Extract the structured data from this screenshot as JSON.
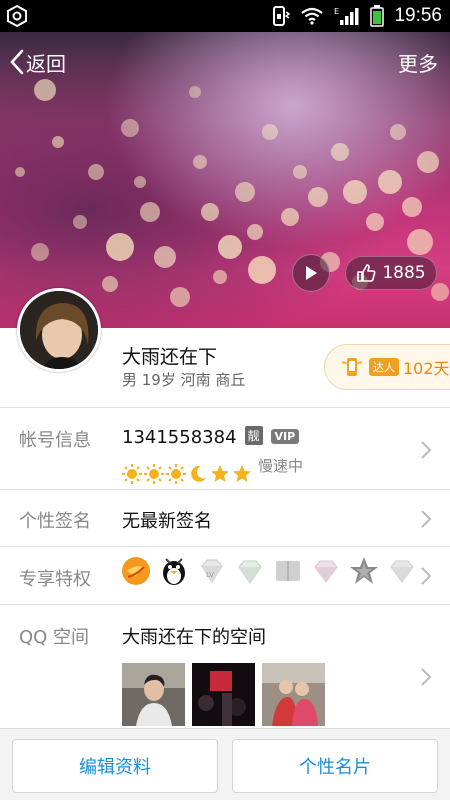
{
  "status_bar": {
    "time": "19:56"
  },
  "header": {
    "back_label": "返回",
    "more_label": "更多",
    "likes": "1885"
  },
  "profile": {
    "name": "大雨还在下",
    "details": "男 19岁 河南 商丘",
    "talent_tag": "达人",
    "talent_days": "102天"
  },
  "account": {
    "label": "帐号信息",
    "qq_number": "1341558384",
    "pretty_badge": "靓",
    "vip_badge": "VIP",
    "speed_text": "慢速中",
    "level_icons": [
      "sun-icon",
      "sun-icon",
      "sun-icon",
      "moon-icon",
      "star-icon",
      "star-icon"
    ]
  },
  "signature": {
    "label": "个性签名",
    "value": "无最新签名"
  },
  "privileges": {
    "label": "专享特权",
    "icons": [
      "yellow-diamond-icon",
      "penguin-icon",
      "red-diamond-icon",
      "green-diamond-icon",
      "book-icon",
      "pink-diamond-icon",
      "star-badge-icon",
      "blue-diamond-icon"
    ]
  },
  "qzone": {
    "label": "QQ 空间",
    "title": "大雨还在下的空间"
  },
  "bottom": {
    "edit_label": "编辑资料",
    "card_label": "个性名片"
  },
  "colors": {
    "accent_blue": "#1a8fd8",
    "talent_orange": "#f08a00"
  }
}
